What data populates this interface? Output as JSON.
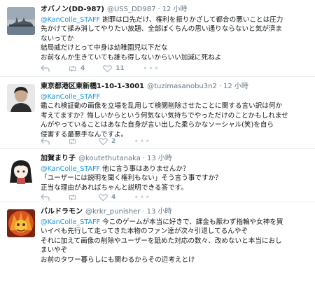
{
  "tweets": [
    {
      "name": "オバノン(DD-987)",
      "handle": "@USS_DD987",
      "time": "12 小時",
      "reply_to": "@KanColle_STAFF",
      "lines": [
        " 謝罪は口先だけ、権利を振りかざして都合の悪いことは圧力",
        "先かけて揉み消してやりたい放題、全部ぼくちんの思い通りならないと気が済ま",
        "ないってか",
        "結局威だけとって中身は幼稚園児以下だな",
        "お前なんか生きていても誰も得しないからいい加減に死ねよ"
      ],
      "retweets": "4",
      "likes": "11"
    },
    {
      "name": "東京都港区東新橋1-10-1-3001",
      "handle": "@tuzimasanobu3n2",
      "time": "12 小時",
      "reply_to": "@KanColle_STAFF",
      "lines": [
        "鑑これ検証動の画像を立場を乱用して検閲削除させたことに関する言い訳は何か",
        "考えてますか？悔しいからという何気ない気持ちでやっただけのことかもしれませ",
        "んがやっていることはあなた自身が言い出した柔らかなソーシャル(笑)を自ら",
        "侵害する最悪手なんですよ。"
      ],
      "retweets": "",
      "likes": "2"
    },
    {
      "name": "加賀まり子",
      "handle": "@koutethutanaka",
      "time": "13 小時",
      "reply_to": "@KanColle_STAFF",
      "lines": [
        " 他に言う事はありませんか？",
        "「ユーザーには説明を聞く権利もない」そう言う事ですか？",
        "正当な理由があればちゃんと説明できる答です。"
      ],
      "retweets": "",
      "likes": "4"
    },
    {
      "name": "バルドラモン",
      "handle": "@krkr_punisher",
      "time": "13 小時",
      "reply_to": "@KanColle_STAFF",
      "lines": [
        " 今このゲームが本当に好きで、課金も厭わず指輪や女神を買",
        "いイベも先行して走ってきた本物のファン達が次々引退してるんやぞ",
        "それに加えて画像の削除やユーザーを舐めた対応の数々、改めないと本当におし",
        "まいやぞ",
        "お前のタワー暮らしにも関わるからその辺考えとけ"
      ],
      "retweets": "",
      "likes": ""
    }
  ],
  "colors": {
    "link": "#1b95e0",
    "meta": "#657786",
    "action": "#aab8c2",
    "border": "#e6ecf0"
  },
  "icons": [
    "reply-icon",
    "retweet-icon",
    "like-icon",
    "more-icon"
  ]
}
